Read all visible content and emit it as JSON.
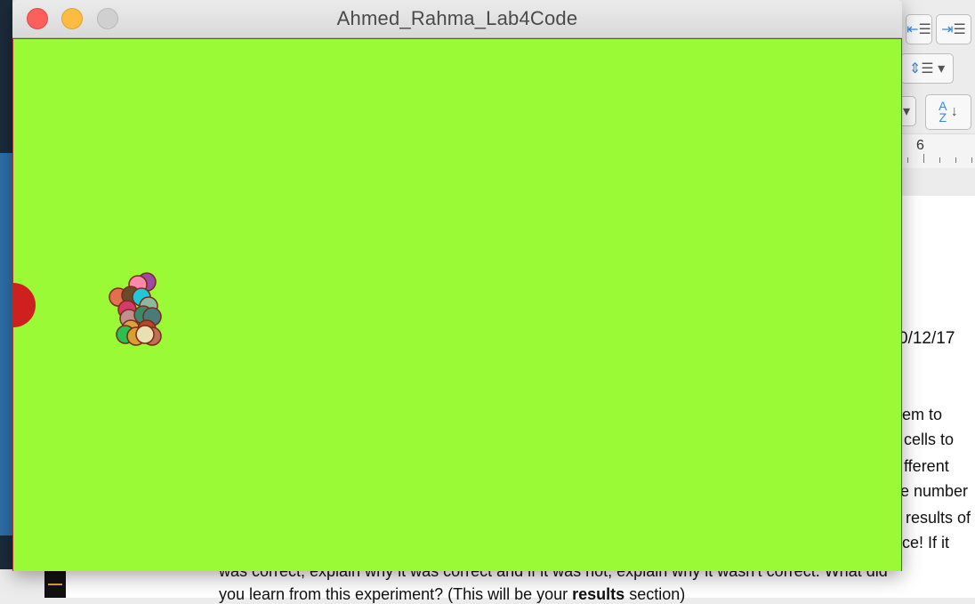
{
  "window": {
    "title": "Ahmed_Rahma_Lab4Code"
  },
  "sketch": {
    "background_color": "#99fa35",
    "border_color": "#aa3333",
    "predator": {
      "color": "#d01f1f"
    },
    "cells": [
      {
        "color": "#9d4aa0"
      },
      {
        "color": "#e07050"
      },
      {
        "color": "#ff88aa"
      },
      {
        "color": "#6a4a2a"
      },
      {
        "color": "#20c8d8"
      },
      {
        "color": "#8ab8a0"
      },
      {
        "color": "#d43a6a"
      },
      {
        "color": "#c09090"
      },
      {
        "color": "#3a8a6a"
      },
      {
        "color": "#4a7a7a"
      },
      {
        "color": "#e0a040"
      },
      {
        "color": "#b04a2a"
      },
      {
        "color": "#2ac050"
      },
      {
        "color": "#d8a030"
      },
      {
        "color": "#c07050"
      },
      {
        "color": "#e8e0b0"
      }
    ]
  },
  "background_app": {
    "ruler_number": "6",
    "date_fragment": "0/12/17",
    "text_fragments": [
      "em to",
      "cells to",
      "fferent",
      "e number",
      "results of",
      "ce! If it"
    ],
    "bottom_line_1": "was correct, explain why it was correct and if it was not, explain why it wasn't correct. What did",
    "bottom_line_2_pre": "you learn from this experiment? (This will be your ",
    "bottom_line_2_bold": "results",
    "bottom_line_2_post": " section)"
  }
}
